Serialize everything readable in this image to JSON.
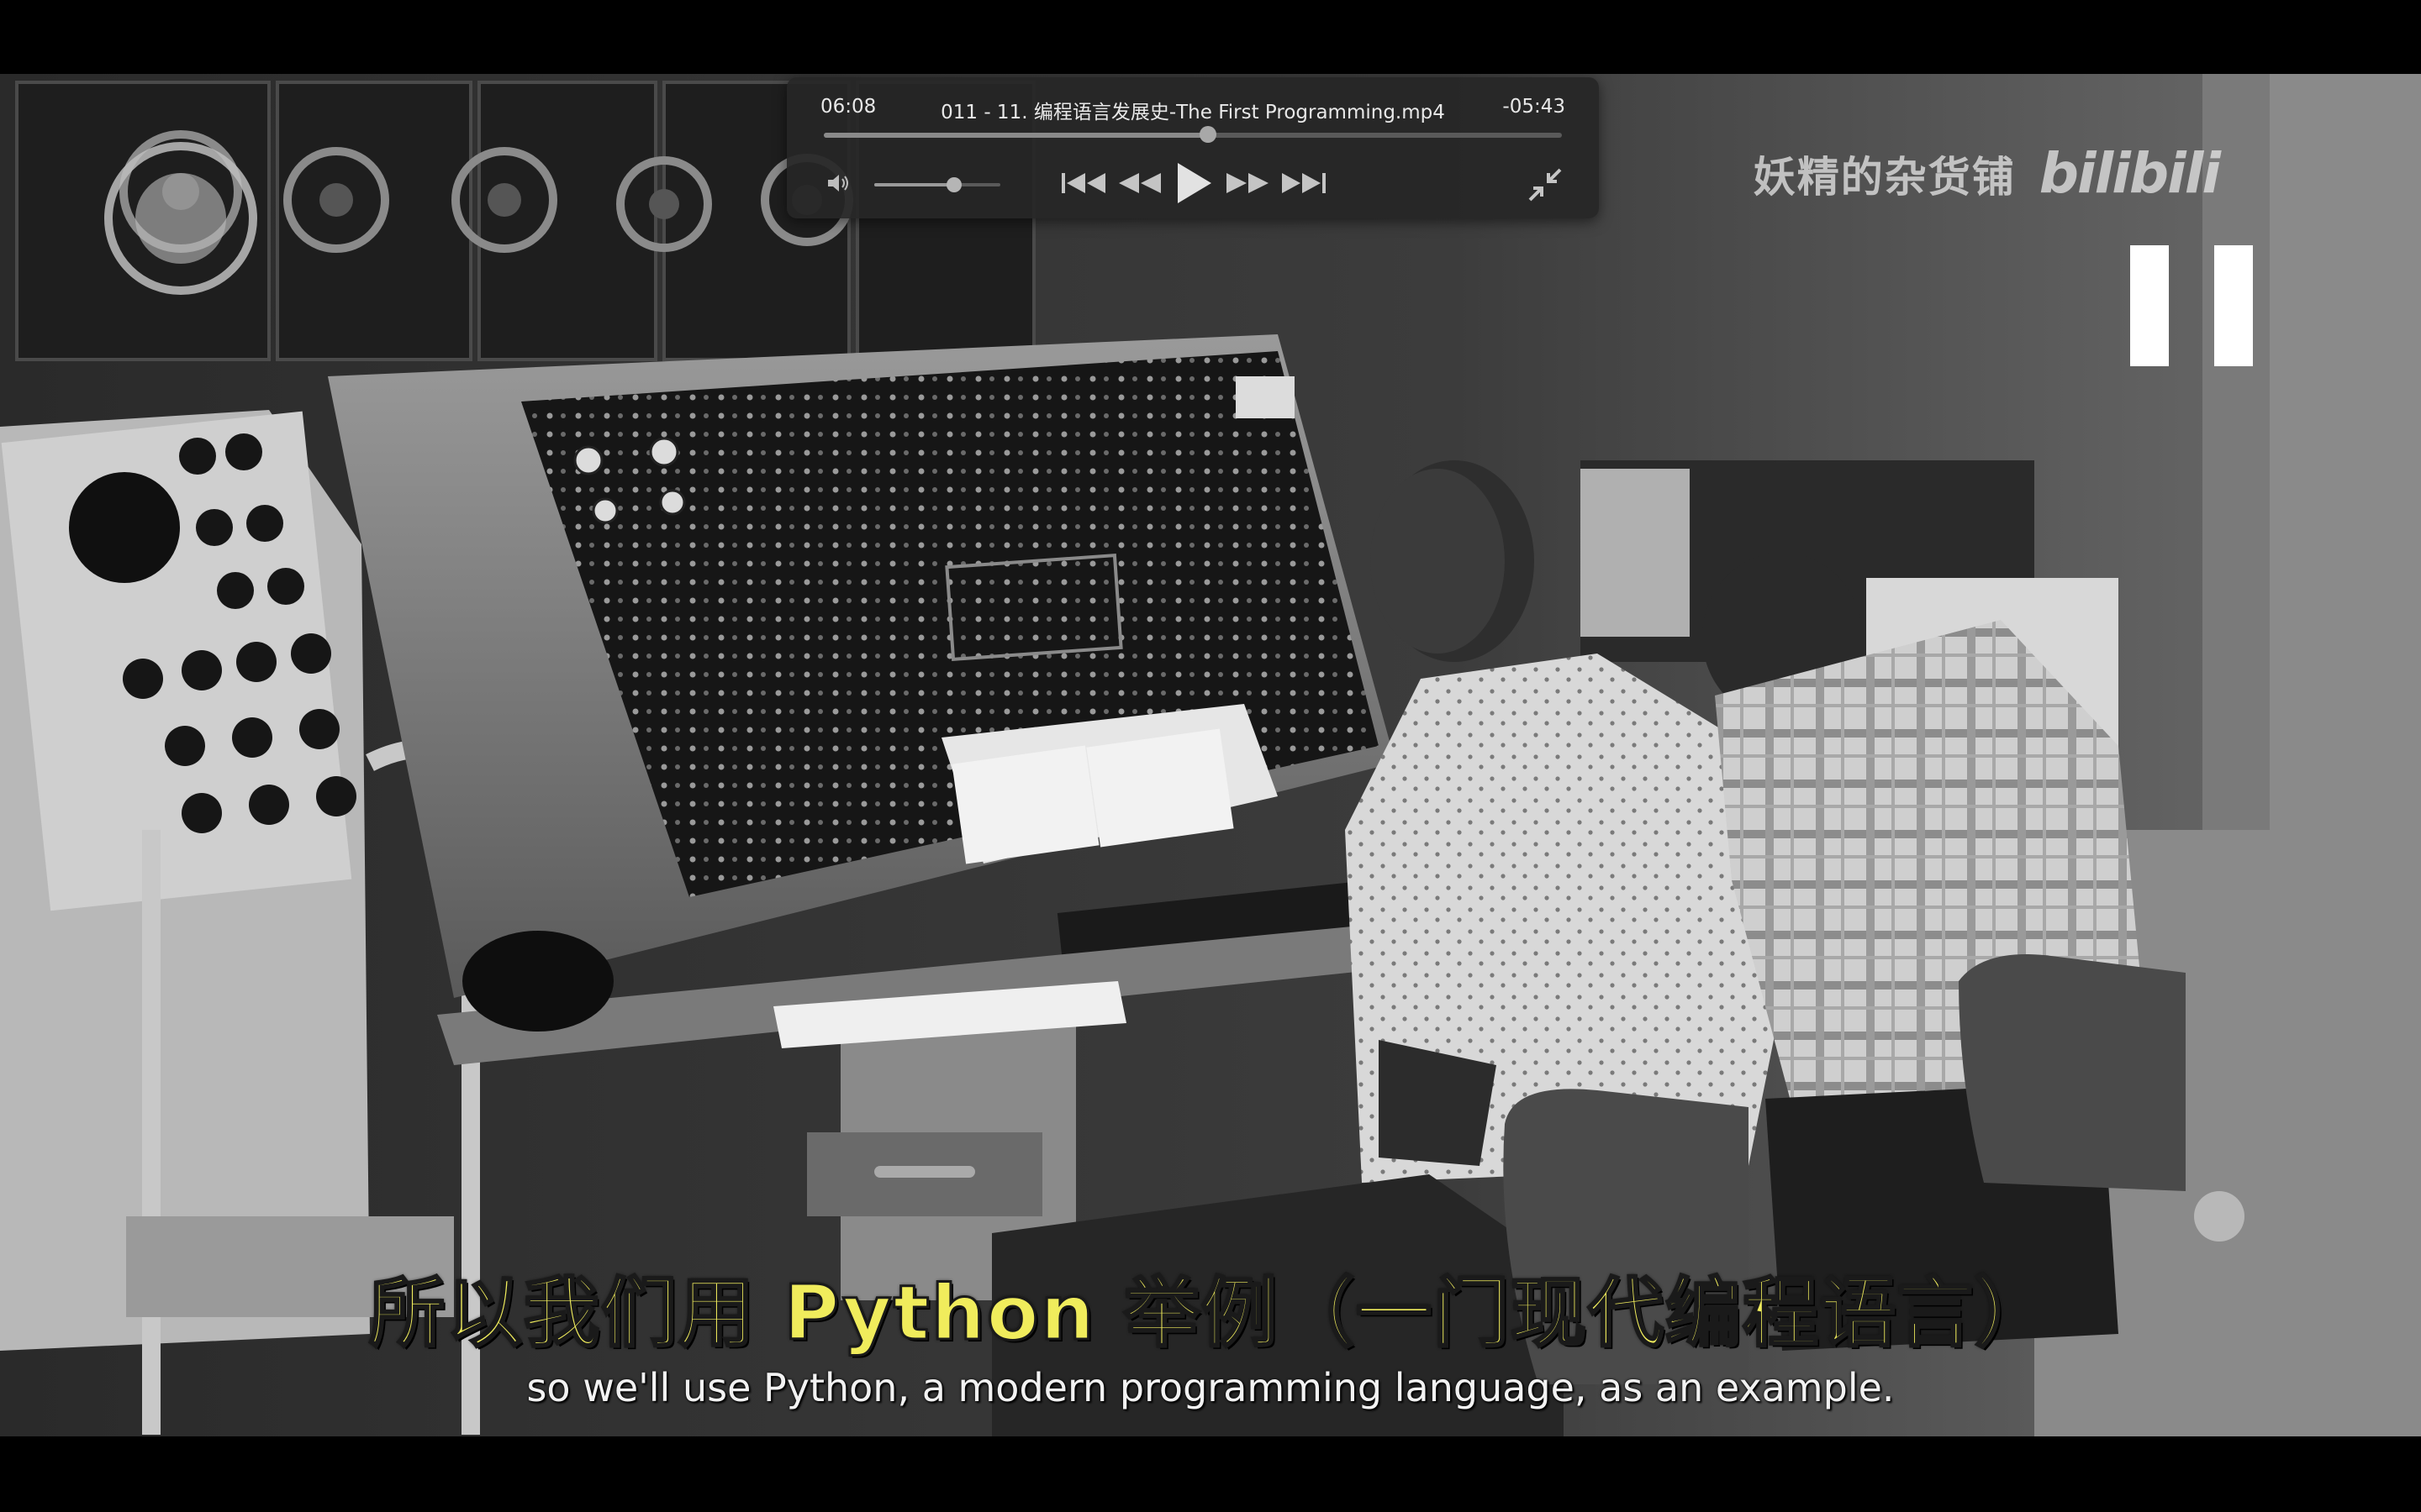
{
  "player": {
    "time_elapsed": "06:08",
    "time_remaining": "-05:43",
    "filename": "011 - 11. 编程语言发展史-The First Programming.mp4",
    "progress_fraction": 0.52,
    "volume_fraction": 0.63,
    "state": "paused"
  },
  "controls": {
    "volume_icon": "speaker-icon",
    "skip_back_icon": "skip-to-start-icon",
    "rewind_icon": "rewind-icon",
    "play_icon": "play-icon",
    "fast_forward_icon": "fast-forward-icon",
    "skip_forward_icon": "skip-to-end-icon",
    "exit_fullscreen_icon": "exit-fullscreen-icon"
  },
  "watermark": {
    "uploader": "妖精的杂货铺",
    "logo": "bilibili"
  },
  "subtitles": {
    "chinese": "所以我们用 Python 举例（一门现代编程语言）",
    "english": "so we'll use Python, a modern programming language, as an example."
  },
  "colors": {
    "subtitle_cn": "#f0ec5c",
    "subtitle_en": "#f2f2f2",
    "hud_bg": "#262626"
  }
}
